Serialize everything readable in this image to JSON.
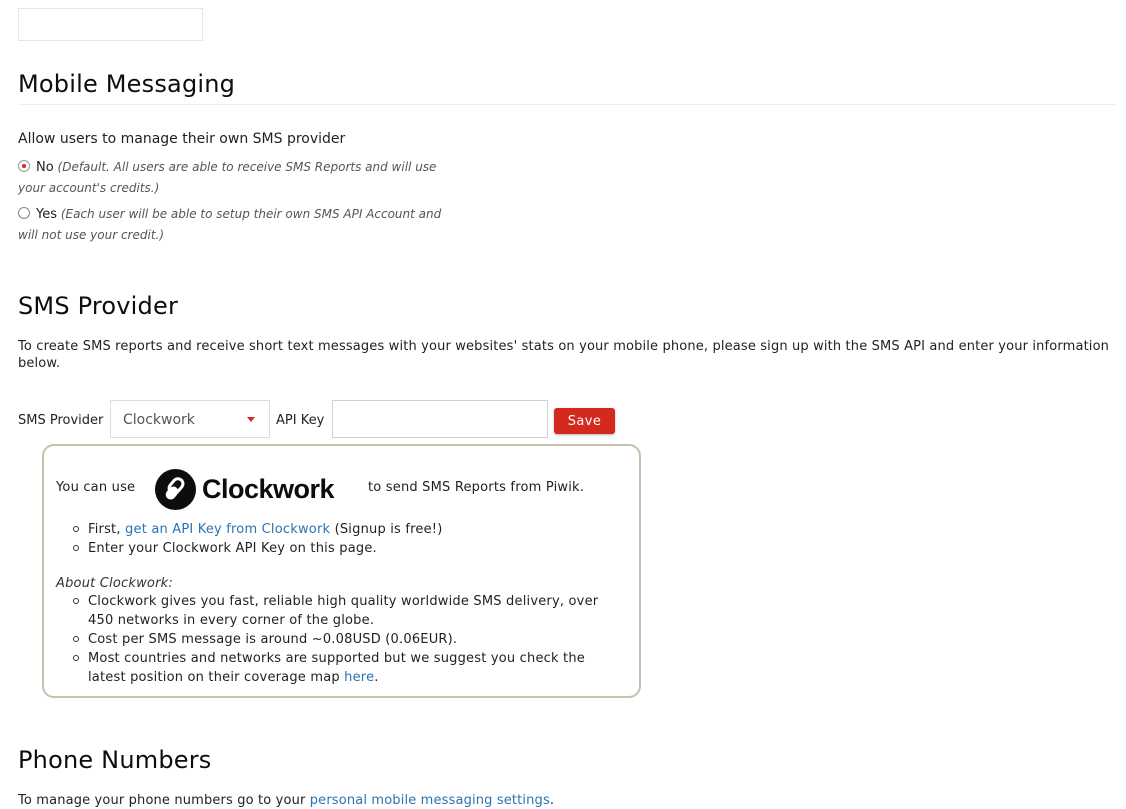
{
  "mobile_messaging": {
    "title": "Mobile Messaging",
    "question": "Allow users to manage their own SMS provider",
    "options": [
      {
        "label": "No",
        "description": "(Default. All users are able to receive SMS Reports and will use your account's credits.)",
        "checked": true
      },
      {
        "label": "Yes",
        "description": "(Each user will be able to setup their own SMS API Account and will not use your credit.)",
        "checked": false
      }
    ]
  },
  "sms_provider": {
    "title": "SMS Provider",
    "description": "To create SMS reports and receive short text messages with your websites' stats on your mobile phone, please sign up with the SMS API and enter your information below.",
    "provider_label": "SMS Provider",
    "provider_value": "Clockwork",
    "api_key_label": "API Key",
    "api_key_value": "",
    "save_label": "Save"
  },
  "info": {
    "you_can_use": "You can use",
    "brand": "Clockwork",
    "to_send": "to send SMS Reports from Piwik.",
    "step1_prefix": "First,",
    "step1_link": "get an API Key from Clockwork",
    "step1_suffix": "(Signup is free!)",
    "step2": "Enter your Clockwork API Key on this page.",
    "about_title": "About Clockwork:",
    "about1": "Clockwork gives you fast, reliable high quality worldwide SMS delivery, over 450 networks in every corner of the globe.",
    "about2": "Cost per SMS message is around ~0.08USD (0.06EUR).",
    "about3_prefix": "Most countries and networks are supported but we suggest you check the latest position on their coverage map",
    "about3_link": "here",
    "about3_suffix": "."
  },
  "phone_numbers": {
    "title": "Phone Numbers",
    "text_prefix": "To manage your phone numbers go to your",
    "link": "personal mobile messaging settings",
    "text_suffix": "."
  },
  "colors": {
    "accent": "#d4291f",
    "link": "#2b73b3",
    "box_border": "#c8bfaf"
  }
}
